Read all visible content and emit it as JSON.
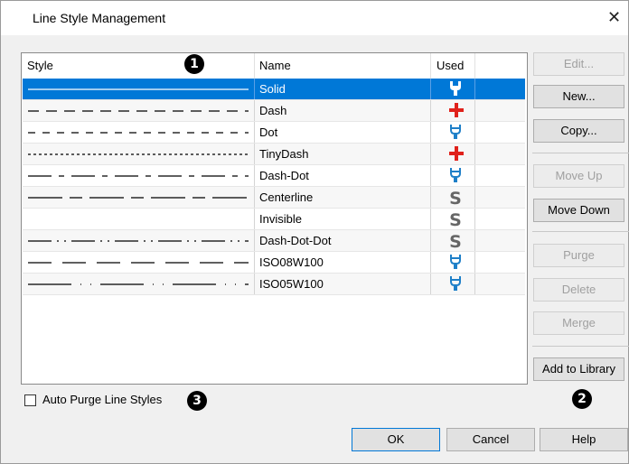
{
  "window": {
    "title": "Line Style Management",
    "close_glyph": "✕"
  },
  "table": {
    "headers": {
      "style": "Style",
      "name": "Name",
      "used": "Used"
    },
    "rows": [
      {
        "name": "Solid",
        "used_icon": "wrench-icon",
        "selected": true
      },
      {
        "name": "Dash",
        "used_icon": "red-plus-icon"
      },
      {
        "name": "Dot",
        "used_icon": "plug-icon"
      },
      {
        "name": "TinyDash",
        "used_icon": "red-plus-icon"
      },
      {
        "name": "Dash-Dot",
        "used_icon": "plug-icon"
      },
      {
        "name": "Centerline",
        "used_icon": "s-icon"
      },
      {
        "name": "Invisible",
        "used_icon": "s-icon"
      },
      {
        "name": "Dash-Dot-Dot",
        "used_icon": "s-icon"
      },
      {
        "name": "ISO08W100",
        "used_icon": "plug-icon"
      },
      {
        "name": "ISO05W100",
        "used_icon": "plug-icon"
      }
    ]
  },
  "buttons": {
    "edit": "Edit...",
    "new": "New...",
    "copy": "Copy...",
    "move_up": "Move Up",
    "move_down": "Move Down",
    "purge": "Purge",
    "delete": "Delete",
    "merge": "Merge",
    "add_to_library": "Add to Library",
    "ok": "OK",
    "cancel": "Cancel",
    "help": "Help"
  },
  "auto_purge": {
    "label": "Auto Purge Line Styles",
    "checked": false
  },
  "callouts": {
    "one": "1",
    "two": "2",
    "three": "3"
  },
  "colors": {
    "selection": "#0078d7",
    "plus": "#e0211b",
    "plug": "#1e7fc8",
    "s": "#666666"
  }
}
